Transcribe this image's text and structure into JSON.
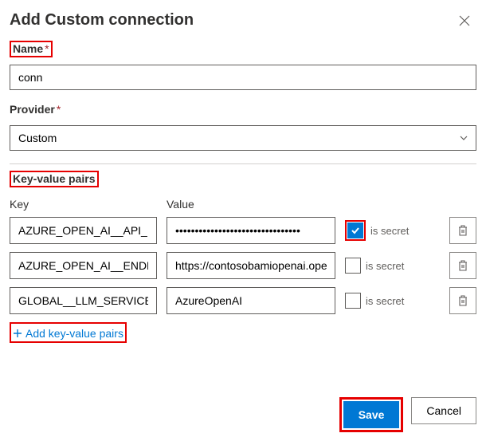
{
  "dialog": {
    "title": "Add Custom connection"
  },
  "name": {
    "label": "Name",
    "value": "conn"
  },
  "provider": {
    "label": "Provider",
    "value": "Custom"
  },
  "kv": {
    "heading": "Key-value pairs",
    "key_label": "Key",
    "value_label": "Value",
    "secret_label": "is secret",
    "add_label": "Add key-value pairs",
    "rows": [
      {
        "key": "AZURE_OPEN_AI__API_KEY",
        "value": "••••••••••••••••••••••••••••••••",
        "secret": true
      },
      {
        "key": "AZURE_OPEN_AI__ENDPOINT",
        "value": "https://contosobamiopenai.ope",
        "secret": false
      },
      {
        "key": "GLOBAL__LLM_SERVICE",
        "value": "AzureOpenAI",
        "secret": false
      }
    ]
  },
  "footer": {
    "save": "Save",
    "cancel": "Cancel"
  }
}
